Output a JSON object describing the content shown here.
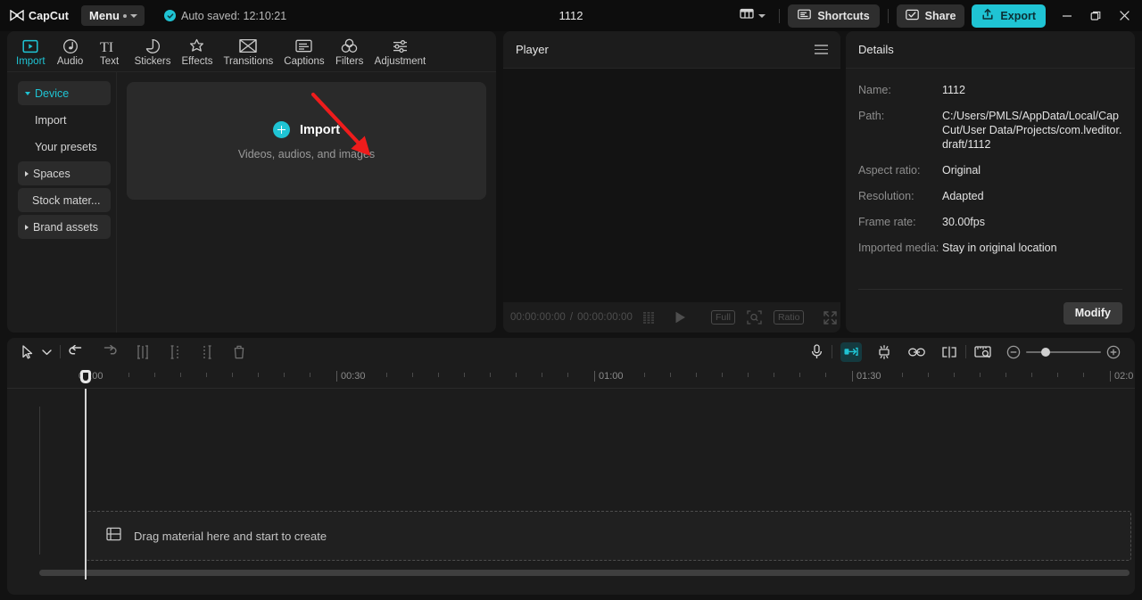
{
  "titlebar": {
    "brand": "CapCut",
    "menu_label": "Menu",
    "autosave_text": "Auto saved: 12:10:21",
    "project_title": "1112",
    "shortcuts_label": "Shortcuts",
    "share_label": "Share",
    "export_label": "Export",
    "accent": "#1fc4d4"
  },
  "function_tabs": [
    {
      "label": "Import",
      "icon": "import-media-icon",
      "active": true
    },
    {
      "label": "Audio",
      "icon": "audio-note-icon",
      "active": false
    },
    {
      "label": "Text",
      "icon": "text-ti-icon",
      "active": false
    },
    {
      "label": "Stickers",
      "icon": "sticker-icon",
      "active": false
    },
    {
      "label": "Effects",
      "icon": "effects-star-icon",
      "active": false
    },
    {
      "label": "Transitions",
      "icon": "transitions-icon",
      "active": false
    },
    {
      "label": "Captions",
      "icon": "captions-icon",
      "active": false
    },
    {
      "label": "Filters",
      "icon": "filters-icon",
      "active": false
    },
    {
      "label": "Adjustment",
      "icon": "adjustment-icon",
      "active": false
    }
  ],
  "categories": [
    {
      "label": "Device",
      "icon": "triangle-down-icon",
      "style": "box-selected"
    },
    {
      "label": "Import",
      "icon": "none",
      "style": "sub"
    },
    {
      "label": "Your presets",
      "icon": "none",
      "style": "sub"
    },
    {
      "label": "Spaces",
      "icon": "triangle-right-icon",
      "style": "box"
    },
    {
      "label": "Stock mater...",
      "icon": "none",
      "style": "box-plain"
    },
    {
      "label": "Brand assets",
      "icon": "triangle-right-icon",
      "style": "box"
    }
  ],
  "dropzone": {
    "import_label": "Import",
    "subtitle": "Videos, audios, and images",
    "plus_icon": "plus-circle-icon",
    "annotation_arrow": "red-arrow-annotation"
  },
  "player": {
    "title": "Player",
    "menu_icon": "hamburger-icon",
    "current_time": "00:00:00:00",
    "separator": "/",
    "total_time": "00:00:00:00",
    "play_icon": "play-icon",
    "quality_label": "Full",
    "zoom_fit_icon": "zoom-fit-icon",
    "ratio_label": "Ratio",
    "fullscreen_icon": "fullscreen-icon"
  },
  "details": {
    "title": "Details",
    "rows": [
      {
        "key": "Name:",
        "value": "1112"
      },
      {
        "key": "Path:",
        "value": "C:/Users/PMLS/AppData/Local/CapCut/User Data/Projects/com.lveditor.draft/1112"
      },
      {
        "key": "Aspect ratio:",
        "value": "Original"
      },
      {
        "key": "Resolution:",
        "value": "Adapted"
      },
      {
        "key": "Frame rate:",
        "value": "30.00fps"
      },
      {
        "key": "Imported media:",
        "value": "Stay in original location"
      }
    ],
    "modify_label": "Modify"
  },
  "timeline": {
    "tools_left": [
      "select-cursor-icon",
      "chevron-down-icon",
      "undo-icon",
      "redo-icon",
      "split-icon",
      "trim-left-icon",
      "trim-right-icon",
      "delete-icon"
    ],
    "tools_right": [
      "microphone-icon",
      "snap-magnet-icon",
      "auto-align-icon",
      "link-icon",
      "split-clip-icon",
      "preview-ruler-icon"
    ],
    "zoom_out_icon": "zoom-out-icon",
    "zoom_in_icon": "zoom-in-icon",
    "ruler_labels": [
      "00:00",
      "00:30",
      "01:00",
      "01:30",
      "02:0"
    ],
    "placeholder_text": "Drag material here and start to create",
    "placeholder_icon": "film-strip-icon",
    "playhead_position": "00:00"
  }
}
